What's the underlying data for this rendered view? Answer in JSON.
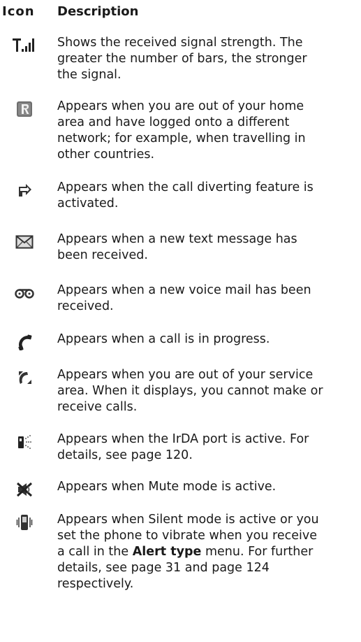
{
  "header": {
    "icon": "Icon",
    "description": "Description"
  },
  "rows": [
    {
      "icon": "signal-strength-icon",
      "text": "Shows the received signal strength. The\ngreater the number of bars, the stronger\nthe signal."
    },
    {
      "icon": "roaming-icon",
      "text": "Appears when you are out of your home\narea and have logged onto a different\nnetwork; for example, when travelling in\nother countries."
    },
    {
      "icon": "call-divert-icon",
      "text": "Appears when the call diverting feature is\nactivated."
    },
    {
      "icon": "text-message-icon",
      "text": "Appears when a new text message has\nbeen received."
    },
    {
      "icon": "voice-mail-icon",
      "text": "Appears when a new voice mail has been\nreceived."
    },
    {
      "icon": "call-in-progress-icon",
      "text": "Appears when a call is in progress."
    },
    {
      "icon": "no-service-icon",
      "text": "Appears when you are out of your service\narea. When it displays, you cannot make or\nreceive calls."
    },
    {
      "icon": "irda-icon",
      "text": "Appears when the IrDA port is active. For\ndetails, see page 120."
    },
    {
      "icon": "mute-icon",
      "text": "Appears when Mute mode is active."
    },
    {
      "icon": "silent-vibrate-icon",
      "text_part1": "Appears when Silent mode is active or you\nset the phone to vibrate when you receive\na call in the ",
      "text_bold": "Alert type",
      "text_part2": " menu. For further\ndetails, see page 31 and page 124\nrespectively."
    }
  ]
}
